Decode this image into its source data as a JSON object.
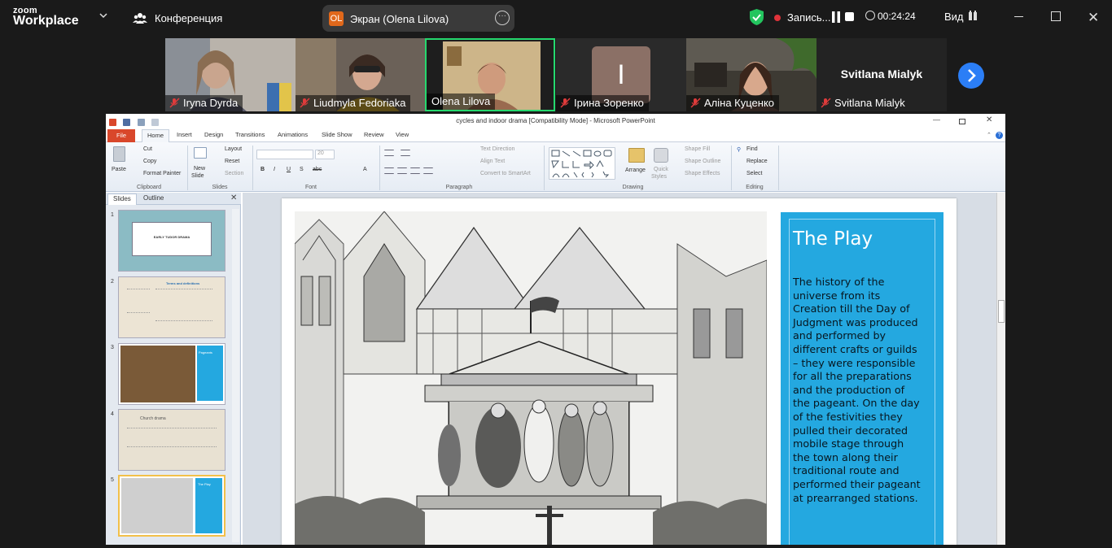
{
  "zoom": {
    "logo_small": "zoom",
    "logo_big": "Workplace",
    "conference_label": "Конференция",
    "share_initials": "OL",
    "share_label": "Экран (Olena Lilova)",
    "recording_label": "Запись...",
    "timer": "00:24:24",
    "view_label": "Вид",
    "accent_green": "#25d86e",
    "accent_blue": "#2b7ef6"
  },
  "participants": [
    {
      "name": "Iryna Dyrda",
      "muted": true,
      "active": false
    },
    {
      "name": "Liudmyla Fedoriaka",
      "muted": true,
      "active": false
    },
    {
      "name": "Olena Lilova",
      "muted": false,
      "active": true
    },
    {
      "name": "Ірина Зоренко",
      "muted": true,
      "active": false,
      "initial": "I"
    },
    {
      "name": "Аліна Куценко",
      "muted": true,
      "active": false
    },
    {
      "name": "Svitlana Mialyk",
      "muted": true,
      "active": false,
      "display_text": "Svitlana Mialyk"
    }
  ],
  "ppt": {
    "window_title": "cycles and indoor drama [Compatibility Mode] - Microsoft PowerPoint",
    "tabs": [
      "File",
      "Home",
      "Insert",
      "Design",
      "Transitions",
      "Animations",
      "Slide Show",
      "Review",
      "View"
    ],
    "ribbon": {
      "clipboard": {
        "label": "Clipboard",
        "paste": "Paste",
        "cut": "Cut",
        "copy": "Copy",
        "format_painter": "Format Painter"
      },
      "slides": {
        "label": "Slides",
        "new_slide": "New",
        "new_slide2": "Slide",
        "layout": "Layout",
        "reset": "Reset",
        "section": "Section"
      },
      "font": {
        "label": "Font",
        "size": "20"
      },
      "paragraph": {
        "label": "Paragraph",
        "text_direction": "Text Direction",
        "align_text": "Align Text",
        "convert": "Convert to SmartArt"
      },
      "drawing": {
        "label": "Drawing",
        "arrange": "Arrange",
        "quick_styles": "Quick",
        "quick_styles2": "Styles",
        "shape_fill": "Shape Fill",
        "shape_outline": "Shape Outline",
        "shape_effects": "Shape Effects"
      },
      "editing": {
        "label": "Editing",
        "find": "Find",
        "replace": "Replace",
        "select": "Select"
      }
    },
    "pane": {
      "tab_slides": "Slides",
      "tab_outline": "Outline",
      "slide_numbers": [
        "1",
        "2",
        "3",
        "4",
        "5"
      ],
      "thumb1_title": "EARLY TUDOR DRAMA",
      "thumb2_title": "Terms and definitions",
      "thumb3_title": "Pageants",
      "thumb4_title": "Church drama",
      "thumb5_title": "The Play"
    },
    "slide": {
      "title": "The Play",
      "body": "The history of the universe from its Creation till the Day of Judgment was produced and performed by different crafts or guilds – they were responsible for all the preparations and the production of the pageant. On the day of the festivities they pulled their decorated mobile stage through the town along their traditional route and performed their pageant at prearranged stations.",
      "accent_color": "#24a8e0"
    }
  }
}
